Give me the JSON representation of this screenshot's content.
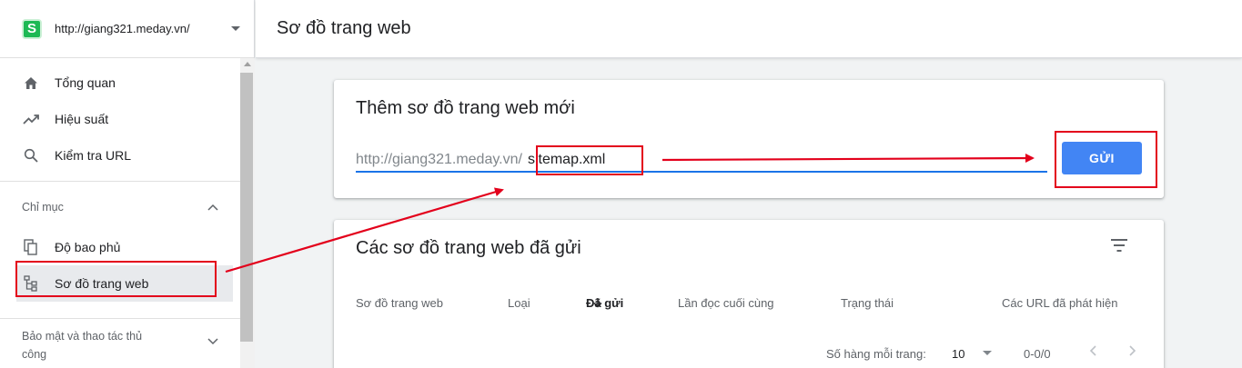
{
  "sidebar": {
    "property_url": "http://giang321.meday.vn/",
    "logo_letter": "S",
    "items": [
      {
        "label": "Tổng quan",
        "icon": "home-icon"
      },
      {
        "label": "Hiệu suất",
        "icon": "trending-up-icon"
      },
      {
        "label": "Kiểm tra URL",
        "icon": "search-icon"
      }
    ],
    "index_section": {
      "label": "Chỉ mục",
      "items": [
        {
          "label": "Độ bao phủ",
          "icon": "copy-icon"
        },
        {
          "label": "Sơ đồ trang web",
          "icon": "sitemap-icon"
        }
      ]
    },
    "security_section": {
      "label_line1": "Bảo mật và thao tác thủ",
      "label_line2": "công"
    }
  },
  "header": {
    "title": "Sơ đồ trang web"
  },
  "add_card": {
    "title": "Thêm sơ đồ trang web mới",
    "url_prefix": "http://giang321.meday.vn/",
    "input_value": "sitemap.xml",
    "submit_label": "GỬI"
  },
  "list_card": {
    "title": "Các sơ đồ trang web đã gửi",
    "columns": [
      "Sơ đồ trang web",
      "Loại",
      "Đã gửi",
      "Lần đọc cuối cùng",
      "Trạng thái",
      "Các URL đã phát hiện"
    ],
    "rows_per_page_label": "Số hàng mỗi trang:",
    "rows_per_page_value": "10",
    "range": "0-0/0"
  },
  "colors": {
    "accent": "#1a73e8",
    "button": "#4285f4",
    "annotation": "#e3001b",
    "logo": "#1db954"
  }
}
